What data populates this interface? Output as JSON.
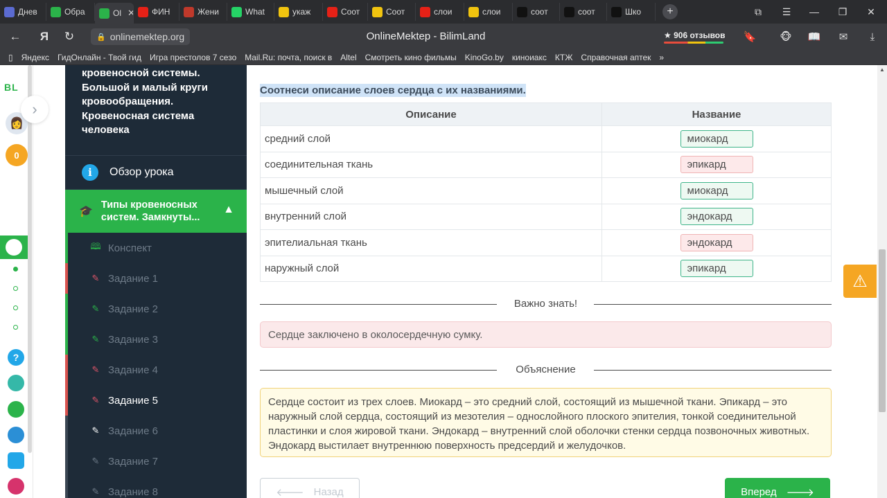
{
  "browser": {
    "tabs": [
      {
        "label": "Днев",
        "fav_color": "#5b6bd1",
        "icon": "hand-icon"
      },
      {
        "label": "Обра",
        "fav_color": "#2bb34a",
        "icon": "bilimland-icon"
      },
      {
        "label": "Ol",
        "fav_color": "#2bb34a",
        "icon": "bilimland-icon",
        "active": true
      },
      {
        "label": "ФИН",
        "fav_color": "#e62117",
        "icon": "youtube-icon"
      },
      {
        "label": "Жени",
        "fav_color": "#c0392b",
        "icon": "myfox-icon"
      },
      {
        "label": "What",
        "fav_color": "#25d366",
        "icon": "whatsapp-icon"
      },
      {
        "label": "укаж",
        "fav_color": "#f1c40f",
        "icon": "image-icon"
      },
      {
        "label": "Соот",
        "fav_color": "#e62117",
        "icon": "yandex-icon"
      },
      {
        "label": "Соот",
        "fav_color": "#f1c40f",
        "icon": "image-icon"
      },
      {
        "label": "слои",
        "fav_color": "#e62117",
        "icon": "yandex-icon"
      },
      {
        "label": "слои",
        "fav_color": "#f1c40f",
        "icon": "image-icon"
      },
      {
        "label": "соот",
        "fav_color": "#111111",
        "icon": "znanija-icon"
      },
      {
        "label": "соот",
        "fav_color": "#111111",
        "icon": "znanija-icon"
      },
      {
        "label": "Шко",
        "fav_color": "#111111",
        "icon": "znanija-icon"
      }
    ],
    "url": "onlinemektep.org",
    "page_title": "OnlineMektep - BilimLand",
    "reviews": "★ 906 отзывов",
    "bookmarks": [
      "Яндекс",
      "ГидОнлайн - Твой гид",
      "Игра престолов 7 сезо",
      "Mail.Ru: почта, поиск в",
      "Altel",
      "Смотреть кино фильмы",
      "KinoGo.by",
      "киноиакс",
      "КТЖ",
      "Справочная аптек",
      "»"
    ]
  },
  "rail": {
    "logo": "BL",
    "coins": "0",
    "help": "?"
  },
  "sidebar": {
    "title": "кровеносной системы. Большой и малый круги кровообращения. Кровеносная система человека",
    "overview": "Обзор урока",
    "section": "Типы кровеносных систем. Замкнуты...",
    "items": [
      {
        "label": "Конспект",
        "state": "neutral-green",
        "icon": "book-icon"
      },
      {
        "label": "Задание 1",
        "state": "wrong",
        "icon": "edit-icon"
      },
      {
        "label": "Задание 2",
        "state": "correct",
        "icon": "edit-icon"
      },
      {
        "label": "Задание 3",
        "state": "correct",
        "icon": "edit-icon"
      },
      {
        "label": "Задание 4",
        "state": "wrong",
        "icon": "edit-icon"
      },
      {
        "label": "Задание 5",
        "state": "current",
        "icon": "edit-icon"
      },
      {
        "label": "Задание 6",
        "state": "none",
        "icon": "edit-icon"
      },
      {
        "label": "Задание 7",
        "state": "none",
        "icon": "edit-icon"
      },
      {
        "label": "Задание 8",
        "state": "none",
        "icon": "edit-icon"
      }
    ]
  },
  "task": {
    "question": "Соотнеси описание слоев сердца с их названиями.",
    "col_description": "Описание",
    "col_name": "Название",
    "rows": [
      {
        "description": "средний слой",
        "answer": "миокард",
        "correct": true
      },
      {
        "description": "соединительная ткань",
        "answer": "эпикард",
        "correct": false
      },
      {
        "description": "мышечный слой",
        "answer": "миокард",
        "correct": true
      },
      {
        "description": "внутренний слой",
        "answer": "эндокард",
        "correct": true
      },
      {
        "description": "эпителиальная ткань",
        "answer": "эндокард",
        "correct": false
      },
      {
        "description": "наружный слой",
        "answer": "эпикард",
        "correct": true
      }
    ],
    "important_label": "Важно знать!",
    "important_text": "Сердце заключено в околосердечную сумку.",
    "explanation_label": "Объяснение",
    "explanation_text": "Сердце состоит из трех слоев. Миокард – это средний слой, состоящий из мышечной ткани. Эпикард – это наружный слой сердца, состоящий из мезотелия – однослойного плоского эпителия, тонкой соединительной пластинки и слоя жировой ткани. Эндокард – внутренний слой оболочки стенки сердца позвоночных животных. Эндокард выстилает внутреннюю поверхность предсердий и желудочков.",
    "back_label": "Назад",
    "next_label": "Вперед"
  },
  "colors": {
    "brand_green": "#2bb34a",
    "sidebar_bg": "#1e2b38",
    "wrong_red": "#e0566a",
    "warning_orange": "#f5a623"
  }
}
